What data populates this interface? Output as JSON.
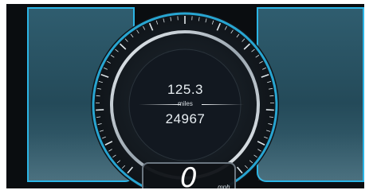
{
  "trip": {
    "value": "125.3",
    "unit": "miles"
  },
  "odometer": {
    "value": "24967"
  },
  "speedometer": {
    "speed": "0",
    "unit": "mph"
  },
  "colors": {
    "accent": "#2bb5e6",
    "panel": "#2f5d6f",
    "background": "#0a0d10",
    "text": "#e8eef2"
  }
}
